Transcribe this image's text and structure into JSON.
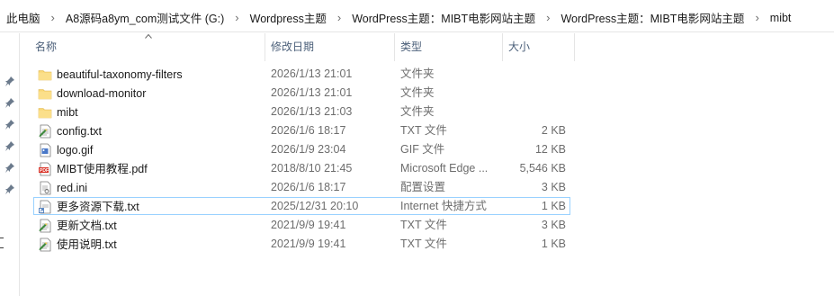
{
  "breadcrumb": [
    "此电脑",
    "A8源码a8ym_com测试文件 (G:)",
    "Wordpress主题",
    "WordPress主题：MIBT电影网站主题",
    "WordPress主题：MIBT电影网站主题",
    "mibt"
  ],
  "columns": {
    "name": "名称",
    "date": "修改日期",
    "type": "类型",
    "size": "大小"
  },
  "files": [
    {
      "name": "beautiful-taxonomy-filters",
      "date": "2026/1/13 21:01",
      "type": "文件夹",
      "size": "",
      "icon": "folder-icon"
    },
    {
      "name": "download-monitor",
      "date": "2026/1/13 21:01",
      "type": "文件夹",
      "size": "",
      "icon": "folder-icon"
    },
    {
      "name": "mibt",
      "date": "2026/1/13 21:03",
      "type": "文件夹",
      "size": "",
      "icon": "folder-icon"
    },
    {
      "name": "config.txt",
      "date": "2026/1/6 18:17",
      "type": "TXT 文件",
      "size": "2 KB",
      "icon": "text-file-icon"
    },
    {
      "name": "logo.gif",
      "date": "2026/1/9 23:04",
      "type": "GIF 文件",
      "size": "12 KB",
      "icon": "image-file-icon"
    },
    {
      "name": "MIBT使用教程.pdf",
      "date": "2018/8/10 21:45",
      "type": "Microsoft Edge ...",
      "size": "5,546 KB",
      "icon": "pdf-file-icon"
    },
    {
      "name": "red.ini",
      "date": "2026/1/6 18:17",
      "type": "配置设置",
      "size": "3 KB",
      "icon": "ini-file-icon"
    },
    {
      "name": "更多资源下载.txt",
      "date": "2025/12/31 20:10",
      "type": "Internet 快捷方式",
      "size": "1 KB",
      "icon": "shortcut-file-icon",
      "selected": true
    },
    {
      "name": "更新文档.txt",
      "date": "2021/9/9 19:41",
      "type": "TXT 文件",
      "size": "3 KB",
      "icon": "text-file-icon"
    },
    {
      "name": "使用说明.txt",
      "date": "2021/9/9 19:41",
      "type": "TXT 文件",
      "size": "1 KB",
      "icon": "text-file-icon"
    }
  ],
  "colors": {
    "header_text": "#4c607a",
    "detail_text": "#6d6d6d",
    "selection_border": "#99d1ff",
    "folder": "#f8d775"
  }
}
